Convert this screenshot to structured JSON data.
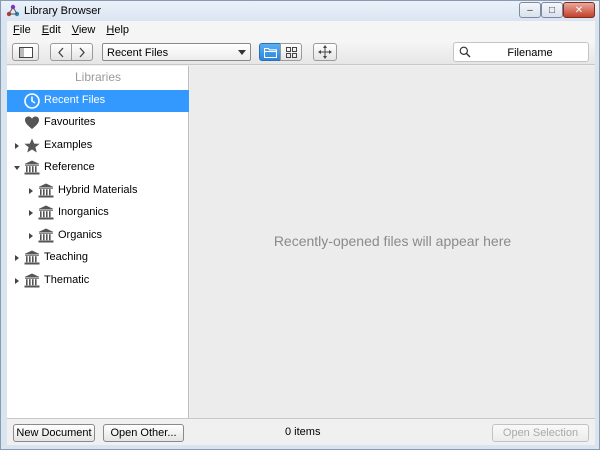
{
  "window": {
    "title": "Library Browser",
    "controls": {
      "minimize": "–",
      "maximize": "□",
      "close": "✕"
    }
  },
  "menubar": {
    "items": [
      {
        "accel": "F",
        "rest": "ile"
      },
      {
        "accel": "E",
        "rest": "dit"
      },
      {
        "accel": "V",
        "rest": "iew"
      },
      {
        "accel": "H",
        "rest": "elp"
      }
    ]
  },
  "toolbar": {
    "location_value": "Recent Files",
    "search_value": "Filename",
    "active_view": "folder-view"
  },
  "sidebar": {
    "header": "Libraries",
    "items": [
      {
        "label": "Recent Files",
        "icon": "clock-icon",
        "selected": true
      },
      {
        "label": "Favourites",
        "icon": "heart-icon"
      },
      {
        "label": "Examples",
        "icon": "star-icon",
        "expandable": "closed"
      },
      {
        "label": "Reference",
        "icon": "library-icon",
        "expandable": "open"
      },
      {
        "label": "Hybrid Materials",
        "icon": "library-icon",
        "expandable": "closed",
        "indent": 1
      },
      {
        "label": "Inorganics",
        "icon": "library-icon",
        "expandable": "closed",
        "indent": 1
      },
      {
        "label": "Organics",
        "icon": "library-icon",
        "expandable": "closed",
        "indent": 1
      },
      {
        "label": "Teaching",
        "icon": "library-icon",
        "expandable": "closed"
      },
      {
        "label": "Thematic",
        "icon": "library-icon",
        "expandable": "closed"
      }
    ]
  },
  "content": {
    "empty_message": "Recently-opened files will appear here"
  },
  "bottombar": {
    "new_document": "New Document",
    "open_other": "Open Other...",
    "item_count": "0 items",
    "open_selection": "Open Selection"
  },
  "colors": {
    "selection": "#3399ff",
    "active_toggle": "#2a86d8",
    "content_bg": "#ececec",
    "frame": "#d9e4f1"
  }
}
